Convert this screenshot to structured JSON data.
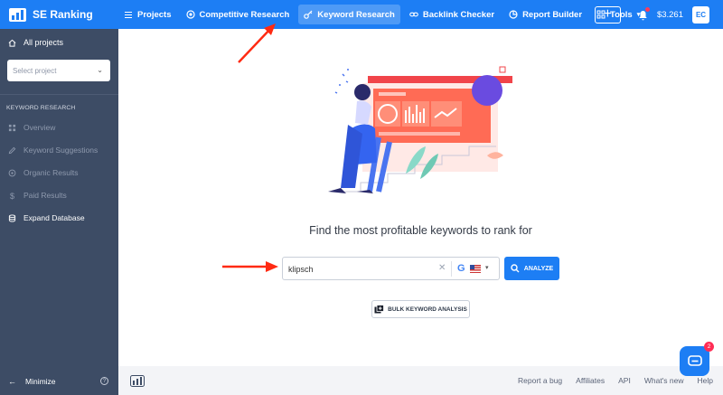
{
  "app": {
    "name": "SE Ranking"
  },
  "nav": {
    "items": [
      {
        "label": "Projects",
        "icon": "projects-icon"
      },
      {
        "label": "Competitive Research",
        "icon": "target-icon"
      },
      {
        "label": "Keyword Research",
        "icon": "key-icon",
        "active": true
      },
      {
        "label": "Backlink Checker",
        "icon": "link-icon"
      },
      {
        "label": "Report Builder",
        "icon": "report-icon"
      },
      {
        "label": "Tools",
        "icon": "grid-icon"
      }
    ],
    "balance": "$3.261",
    "avatar": "EC"
  },
  "sidebar": {
    "all_projects": "All projects",
    "select_placeholder": "Select project",
    "section_title": "KEYWORD RESEARCH",
    "items": [
      {
        "label": "Overview",
        "icon": "overview-icon"
      },
      {
        "label": "Keyword Suggestions",
        "icon": "pencil-icon"
      },
      {
        "label": "Organic Results",
        "icon": "organic-icon"
      },
      {
        "label": "Paid Results",
        "icon": "dollar-icon"
      },
      {
        "label": "Expand Database",
        "icon": "database-icon"
      }
    ],
    "minimize": "Minimize",
    "help": "?"
  },
  "main": {
    "headline": "Find the most profitable keywords to rank for",
    "search_value": "klipsch",
    "engine": "G",
    "analyze_label": "ANALYZE",
    "bulk_label": "BULK KEYWORD ANALYSIS"
  },
  "footer": {
    "links": [
      "Report a bug",
      "Affiliates",
      "API",
      "What's new",
      "Help"
    ]
  },
  "chat": {
    "badge": "2"
  },
  "colors": {
    "brand_blue": "#1d7ef4",
    "sidebar_bg": "#3d4c65",
    "annotation_red": "#ff2a12"
  }
}
